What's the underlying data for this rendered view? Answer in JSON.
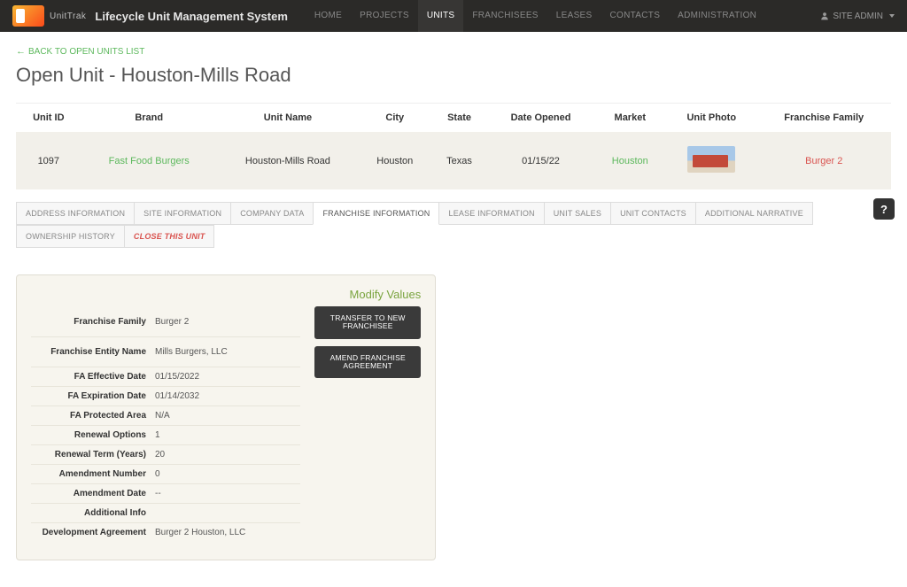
{
  "header": {
    "logo_text": "UnitTrak",
    "app_title": "Lifecycle Unit Management System",
    "nav": [
      "HOME",
      "PROJECTS",
      "UNITS",
      "FRANCHISEES",
      "LEASES",
      "CONTACTS",
      "ADMINISTRATION"
    ],
    "active_nav": "UNITS",
    "user_label": "SITE ADMIN"
  },
  "back_link": "BACK TO OPEN UNITS LIST",
  "page_title": "Open Unit - Houston-Mills Road",
  "unit_table": {
    "headers": [
      "Unit ID",
      "Brand",
      "Unit Name",
      "City",
      "State",
      "Date Opened",
      "Market",
      "Unit Photo",
      "Franchise Family"
    ],
    "row": {
      "unit_id": "1097",
      "brand": "Fast Food Burgers",
      "unit_name": "Houston-Mills Road",
      "city": "Houston",
      "state": "Texas",
      "date_opened": "01/15/22",
      "market": "Houston",
      "franchise_family": "Burger 2"
    }
  },
  "tabs": [
    "ADDRESS INFORMATION",
    "SITE INFORMATION",
    "COMPANY DATA",
    "FRANCHISE INFORMATION",
    "LEASE INFORMATION",
    "UNIT SALES",
    "UNIT CONTACTS",
    "ADDITIONAL NARRATIVE",
    "OWNERSHIP HISTORY",
    "CLOSE THIS UNIT"
  ],
  "active_tab": "FRANCHISE INFORMATION",
  "panel": {
    "modify_label": "Modify Values",
    "actions": {
      "transfer": "TRANSFER TO NEW FRANCHISEE",
      "amend": "AMEND FRANCHISE AGREEMENT"
    },
    "rows": [
      {
        "label": "Franchise Family",
        "value": "Burger 2"
      },
      {
        "label": "Franchise Entity Name",
        "value": "Mills Burgers, LLC"
      },
      {
        "label": "FA Effective Date",
        "value": "01/15/2022"
      },
      {
        "label": "FA Expiration Date",
        "value": "01/14/2032"
      },
      {
        "label": "FA Protected Area",
        "value": "N/A"
      },
      {
        "label": "Renewal Options",
        "value": "1"
      },
      {
        "label": "Renewal Term (Years)",
        "value": "20"
      },
      {
        "label": "Amendment Number",
        "value": "0"
      },
      {
        "label": "Amendment Date",
        "value": "--"
      },
      {
        "label": "Additional Info",
        "value": ""
      },
      {
        "label": "Development Agreement",
        "value": "Burger 2 Houston, LLC"
      }
    ]
  },
  "help": "?"
}
